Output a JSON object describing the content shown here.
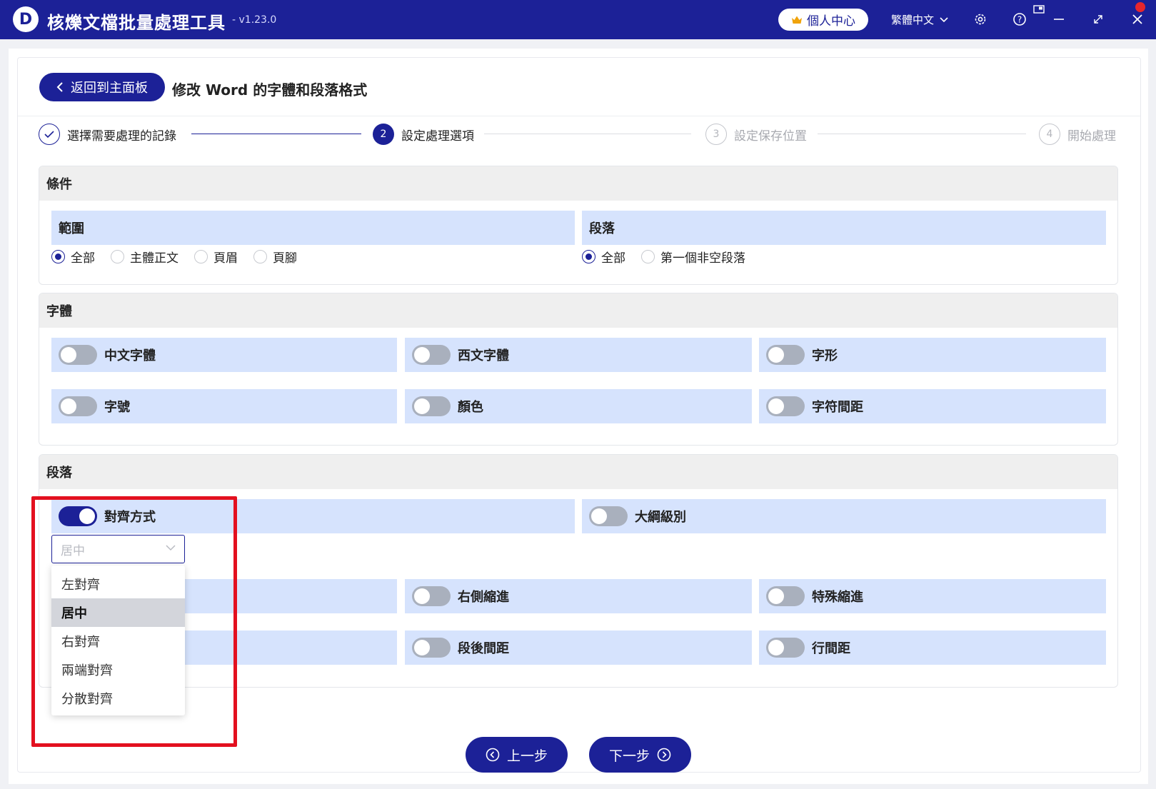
{
  "app": {
    "logo_letter": "D",
    "title": "核爍文檔批量處理工具",
    "version": "- v1.23.0",
    "user_center": "個人中心",
    "language": "繁體中文"
  },
  "page": {
    "back_label": "返回到主面板",
    "title": "修改 Word 的字體和段落格式"
  },
  "steps": [
    {
      "num": "✓",
      "label": "選擇需要處理的記錄",
      "state": "done"
    },
    {
      "num": "2",
      "label": "設定處理選項",
      "state": "active"
    },
    {
      "num": "3",
      "label": "設定保存位置",
      "state": "pending"
    },
    {
      "num": "4",
      "label": "開始處理",
      "state": "pending"
    }
  ],
  "conditions": {
    "heading": "條件",
    "scope": {
      "label": "範圍",
      "options": [
        "全部",
        "主體正文",
        "頁眉",
        "頁腳"
      ],
      "selected": 0
    },
    "paragraph": {
      "label": "段落",
      "options": [
        "全部",
        "第一個非空段落"
      ],
      "selected": 0
    }
  },
  "font": {
    "heading": "字體",
    "toggles": [
      {
        "label": "中文字體",
        "on": false
      },
      {
        "label": "西文字體",
        "on": false
      },
      {
        "label": "字形",
        "on": false
      },
      {
        "label": "字號",
        "on": false
      },
      {
        "label": "顏色",
        "on": false
      },
      {
        "label": "字符間距",
        "on": false
      }
    ]
  },
  "paragraph": {
    "heading": "段落",
    "alignment": {
      "label": "對齊方式",
      "on": true
    },
    "outline": {
      "label": "大綱級別",
      "on": false
    },
    "select_value": "居中",
    "dropdown_options": [
      "左對齊",
      "居中",
      "右對齊",
      "兩端對齊",
      "分散對齊"
    ],
    "dropdown_selected": 1,
    "row2": [
      {
        "label": "右側縮進",
        "on": false
      },
      {
        "label": "特殊縮進",
        "on": false
      }
    ],
    "row3": [
      {
        "label": "段後間距",
        "on": false
      },
      {
        "label": "行間距",
        "on": false
      }
    ]
  },
  "nav": {
    "prev": "上一步",
    "next": "下一步"
  },
  "colors": {
    "primary": "#1c2197",
    "band": "#d6e3fd",
    "highlight": "#e3101f"
  }
}
